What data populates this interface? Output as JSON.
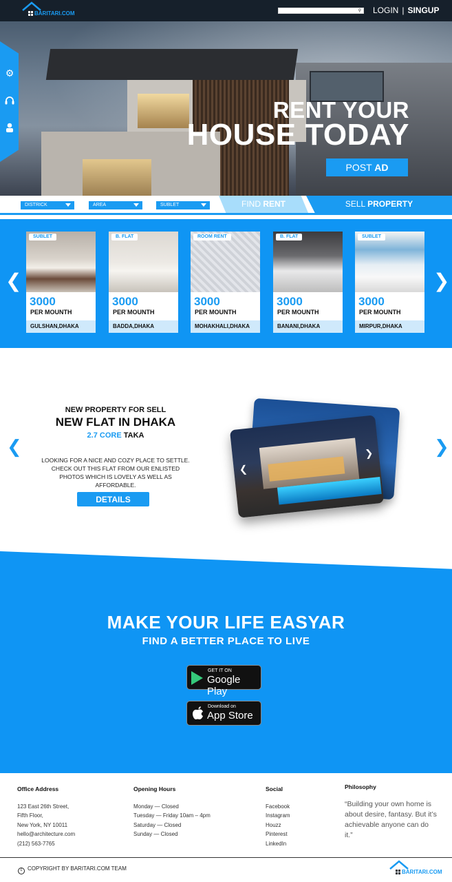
{
  "header": {
    "brand": "BARITARI.COM",
    "search_placeholder": "",
    "login_label": "LOGIN",
    "separator": "|",
    "signup_label": "SINGUP"
  },
  "hero": {
    "title_line1": "RENT YOUR",
    "title_line2": "HOUSE TODAY",
    "post_ad_light": "POST",
    "post_ad_bold": "AD"
  },
  "side_tab": {
    "icons": [
      "gear-icon",
      "headset-icon",
      "user-icon"
    ]
  },
  "filters": {
    "district": "DISTRICK",
    "area": "AREA",
    "type": "SUBLET"
  },
  "tabs": {
    "rent_light": "FIND",
    "rent_bold": "RENT",
    "sell_light": "SELL",
    "sell_bold": "PROPERTY"
  },
  "listings": [
    {
      "tag": "SUBLET",
      "price": "3000",
      "per": "PER MOUNTH",
      "location": "GULSHAN,DHAKA"
    },
    {
      "tag": "B. FLAT",
      "price": "3000",
      "per": "PER MOUNTH",
      "location": "BADDA,DHAKA"
    },
    {
      "tag": "ROOM RENT",
      "price": "3000",
      "per": "PER MOUNTH",
      "location": "MOHAKHALI,DHAKA"
    },
    {
      "tag": "B. FLAT",
      "price": "3000",
      "per": "PER MOUNTH",
      "location": "BANANI,DHAKA"
    },
    {
      "tag": "SUBLET",
      "price": "3000",
      "per": "PER MOUNTH",
      "location": "MIRPUR,DHAKA"
    }
  ],
  "featured": {
    "kicker": "NEW PROPERTY FOR SELL",
    "title": "NEW FLAT IN DHAKA",
    "price_value": "2.7 CORE",
    "price_unit": "TAKA",
    "description": "LOOKING FOR A NICE AND COZY PLACE TO SETTLE. CHECK OUT THIS FLAT FROM OUR ENLISTED PHOTOS WHICH IS LOVELY AS WELL AS AFFORDABLE.",
    "details_label": "DETAILS"
  },
  "app": {
    "title": "MAKE YOUR LIFE EASYAR",
    "subtitle": "FIND A BETTER PLACE TO LIVE",
    "google_small": "GET IT ON",
    "google_big": "Google Play",
    "apple_small": "Download on",
    "apple_big": "App Store"
  },
  "footer": {
    "office": {
      "heading": "Office Address",
      "lines": [
        "123 East 26th Street,",
        "Fifth Floor,",
        "New York, NY 10011",
        "hello@architecture.com",
        "(212) 563-7765"
      ]
    },
    "hours": {
      "heading": "Opening Hours",
      "lines": [
        "Monday — Closed",
        "Tuesday — Friday 10am – 4pm",
        "Saturday — Closed",
        "Sunday — Closed"
      ]
    },
    "social": {
      "heading": "Social",
      "links": [
        "Facebook",
        "Instagram",
        "Houzz",
        "Pinterest",
        "LinkedIn"
      ]
    },
    "philosophy": {
      "heading": "Philosophy",
      "quote": "“Building your own home is about desire, fantasy. But it’s achievable anyone can do it.”"
    },
    "copyright": "COPYRIGHT BY BARITARI.COM TEAM",
    "brand": "BARITARI.COM"
  },
  "colors": {
    "accent": "#1a9bf2",
    "band": "#0f95f4",
    "topbar": "#16202b"
  }
}
